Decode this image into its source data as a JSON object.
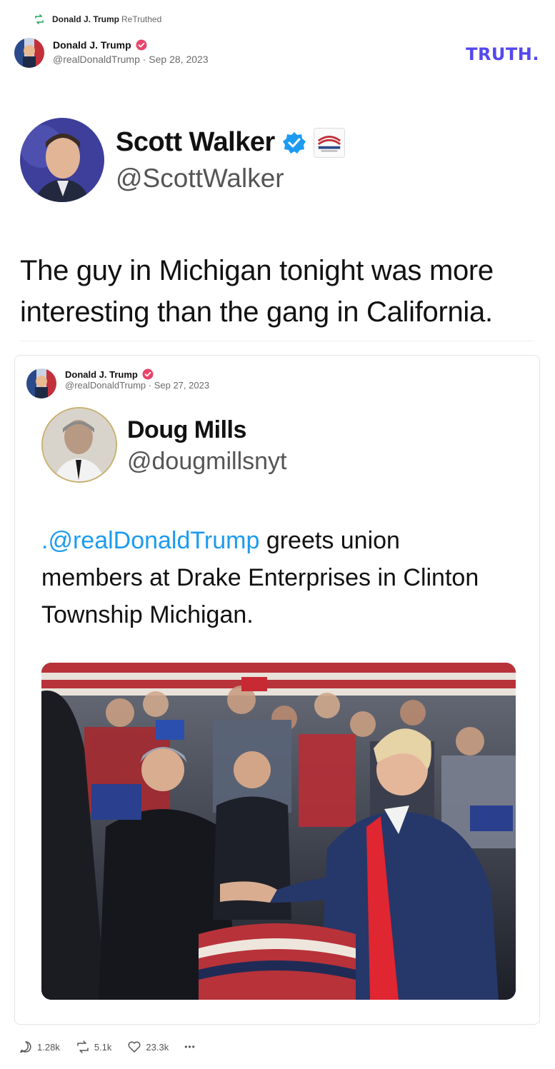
{
  "retruth": {
    "name": "Donald J. Trump",
    "action": "ReTruthed"
  },
  "post": {
    "author": "Donald J. Trump",
    "handle_date": "@realDonaldTrump · Sep 28, 2023",
    "logo": "TRUTH."
  },
  "screenshot": {
    "name": "Scott Walker",
    "handle": "@ScottWalker",
    "text": "The guy in Michigan tonight was more interesting than the gang in California."
  },
  "quote": {
    "author": "Donald J. Trump",
    "handle_date": "@realDonaldTrump · Sep 27, 2023",
    "inner": {
      "name": "Doug Mills",
      "handle": "@dougmillsnyt",
      "mention": ".@realDonaldTrump",
      "text": " greets union members at Drake Enterprises in Clinton Township Michigan."
    }
  },
  "actions": {
    "replies": "1.28k",
    "retruths": "5.1k",
    "likes": "23.3k",
    "more": "•••"
  },
  "colors": {
    "brand": "#5448ee",
    "verified": "#e8456b",
    "mention": "#1d9bf0",
    "retruth_icon": "#22a35a"
  }
}
